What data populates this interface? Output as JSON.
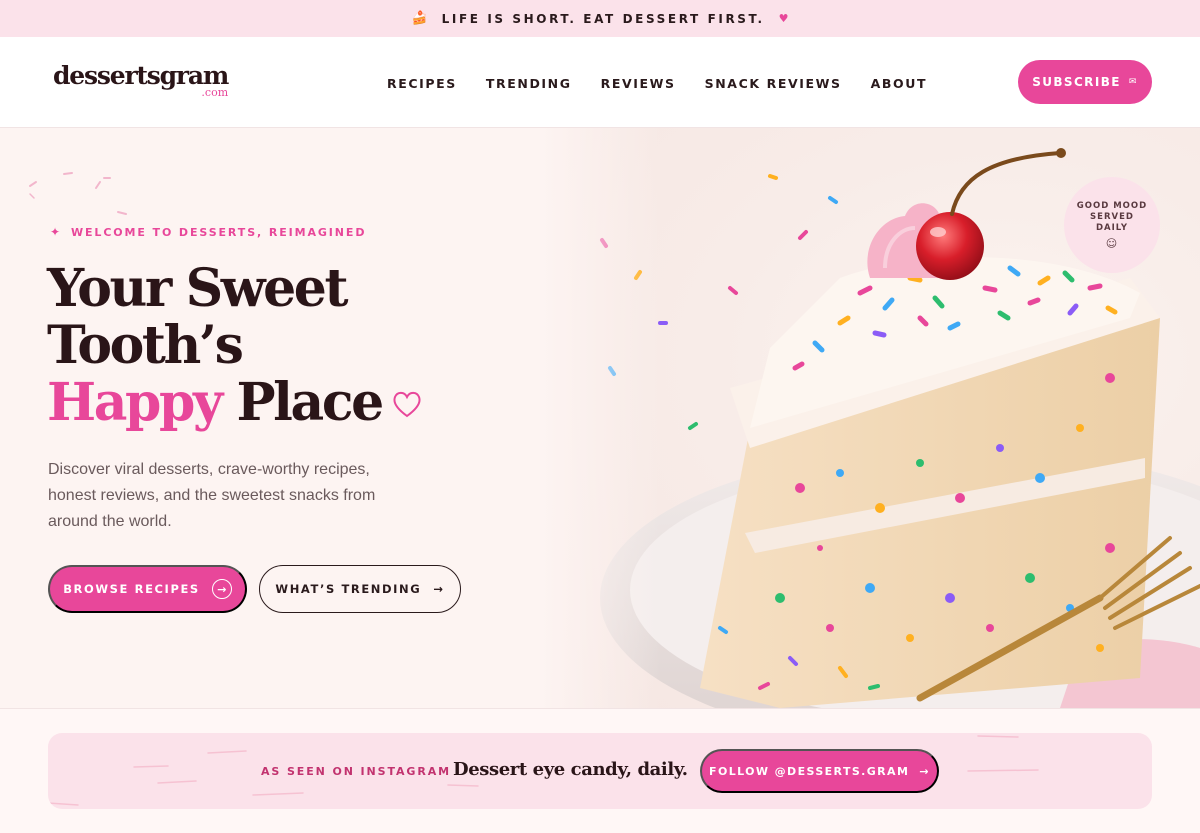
{
  "announcement": {
    "icon": "cake-icon",
    "text": "LIFE IS SHORT. EAT DESSERT FIRST.",
    "heart_icon": "heart-icon"
  },
  "header": {
    "logo_main": "dessertsgram",
    "logo_sub": ".com",
    "nav": [
      "RECIPES",
      "TRENDING",
      "REVIEWS",
      "SNACK REVIEWS",
      "ABOUT"
    ],
    "subscribe_label": "SUBSCRIBE",
    "subscribe_icon": "mail-icon"
  },
  "hero": {
    "eyebrow": "WELCOME TO DESSERTS, REIMAGINED",
    "headline_line1": "Your Sweet",
    "headline_line2": "Tooth’s",
    "headline_pink": "Happy",
    "headline_end": "Place",
    "description": "Discover viral desserts, crave-worthy recipes, honest reviews, and the sweetest snacks from around the world.",
    "primary_button": "BROWSE RECIPES",
    "secondary_button": "WHAT’S TRENDING",
    "badge_line1": "GOOD MOOD",
    "badge_line2": "SERVED",
    "badge_line3": "DAILY",
    "badge_icon": "smile-icon"
  },
  "instagram": {
    "label": "AS SEEN ON INSTAGRAM",
    "tagline": "Dessert eye candy, daily.",
    "follow_button": "FOLLOW @DESSERTS.GRAM"
  },
  "colors": {
    "accent": "#e8479a",
    "blush": "#fbe2ea",
    "ink": "#2a1518",
    "hero_bg": "#fdf4f2"
  }
}
